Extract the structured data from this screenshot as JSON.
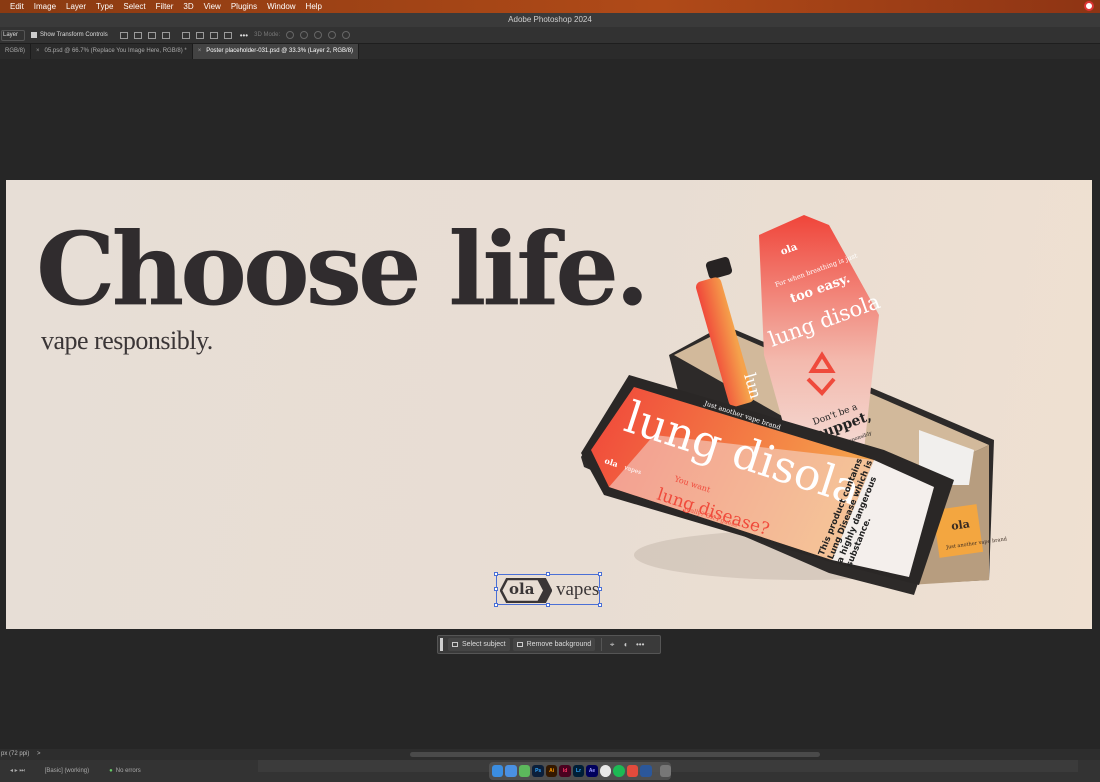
{
  "menubar": {
    "items": [
      "Edit",
      "Image",
      "Layer",
      "Type",
      "Select",
      "Filter",
      "3D",
      "View",
      "Plugins",
      "Window",
      "Help"
    ]
  },
  "window": {
    "title": "Adobe Photoshop 2024"
  },
  "options_bar": {
    "layer_select": "Layer",
    "show_transform_controls": "Show Transform Controls",
    "mode_label": "3D Mode:"
  },
  "tabs": [
    {
      "label": "RGB/8)",
      "active": false
    },
    {
      "label": "05.psd @ 66.7% (Replace You Image Here, RGB/8) *",
      "active": false
    },
    {
      "label": "Poster placeholder-031.psd @ 33.3% (Layer 2, RGB/8)",
      "active": true
    }
  ],
  "poster": {
    "headline": "Choose life.",
    "tagline": "vape responsibly.",
    "logo_mark": "ola",
    "logo_text": "vapes",
    "pack": {
      "brand": "lung disola",
      "small_brand": "ola",
      "small_brand_suffix": "vapes",
      "top_note": "Just another vape brand",
      "pitch_line1": "You want",
      "pitch_line2": "lung disease?",
      "pitch_line3": "really? OK I guess",
      "warning": "This product contains Lung Disease which is a highly dangerous substance.",
      "insert_line1": "For when breathing is just",
      "insert_line2": "too easy.",
      "insert_brand": "lung disola",
      "insert_bottom1": "Don't be a",
      "insert_bottom2": "puppet,",
      "insert_bottom3": "recycle responsibly",
      "side_note": "Just another vape brand",
      "device_label": "lun"
    }
  },
  "context_bar": {
    "select_subject": "Select subject",
    "remove_background": "Remove background",
    "more": "•••"
  },
  "status": {
    "zoom": "px (72 ppi)",
    "arrow": ">"
  },
  "bottom": {
    "basic": "[Basic] (working)",
    "errors": "No errors"
  },
  "dock": [
    "Finder",
    "Mail",
    "Maps",
    "Ps",
    "Ai",
    "Id",
    "Lr",
    "Ae",
    "Chrome",
    "Spotify",
    "Figma",
    "Word",
    "Trash"
  ]
}
